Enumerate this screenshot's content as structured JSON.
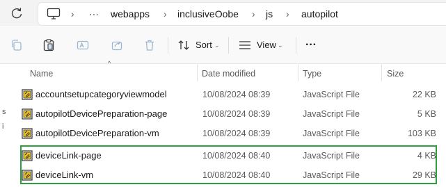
{
  "breadcrumb": {
    "overflow": "···",
    "items": [
      "webapps",
      "inclusiveOobe",
      "js",
      "autopilot"
    ]
  },
  "toolbar": {
    "sort_label": "Sort",
    "view_label": "View",
    "more_label": "···"
  },
  "columns": {
    "name": "Name",
    "date": "Date modified",
    "type": "Type",
    "size": "Size"
  },
  "files": [
    {
      "name": "accountsetupcategoryviewmodel",
      "date": "10/08/2024 08:39",
      "type": "JavaScript File",
      "size": "22 KB"
    },
    {
      "name": "autopilotDevicePreparation-page",
      "date": "10/08/2024 08:39",
      "type": "JavaScript File",
      "size": "5 KB"
    },
    {
      "name": "autopilotDevicePreparation-vm",
      "date": "10/08/2024 08:39",
      "type": "JavaScript File",
      "size": "103 KB"
    },
    {
      "name": "deviceLink-page",
      "date": "10/08/2024 08:40",
      "type": "JavaScript File",
      "size": "4 KB"
    },
    {
      "name": "deviceLink-vm",
      "date": "10/08/2024 08:40",
      "type": "JavaScript File",
      "size": "29 KB"
    }
  ],
  "colors": {
    "highlight": "#2e9e3f",
    "icon_accent": "#f0c419"
  }
}
